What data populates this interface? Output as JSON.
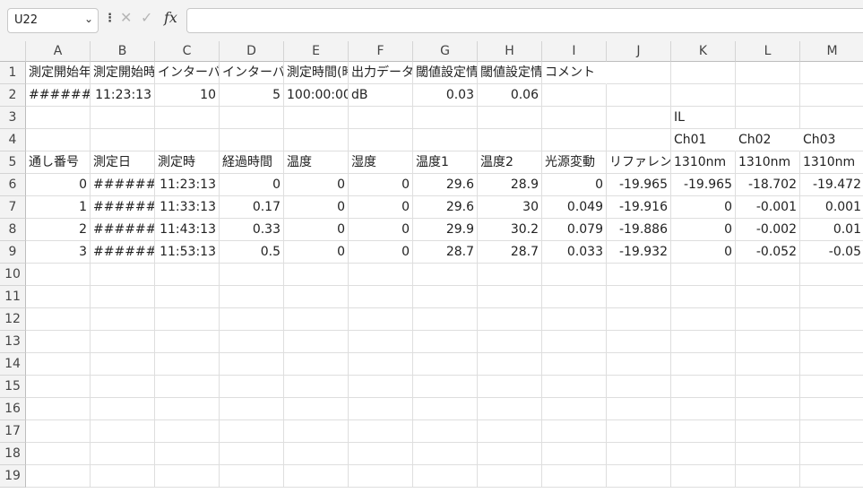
{
  "name_box": {
    "value": "U22",
    "dropdown_icon": "chevron-down-icon"
  },
  "formula_bar": {
    "menu_icon": "more-options-icon",
    "cancel_icon": "cancel-icon",
    "enter_icon": "check-icon",
    "fx_label": "fx",
    "formula": ""
  },
  "columns": [
    "A",
    "B",
    "C",
    "D",
    "E",
    "F",
    "G",
    "H",
    "I",
    "J",
    "K",
    "L",
    "M"
  ],
  "rows": [
    "1",
    "2",
    "3",
    "4",
    "5",
    "6",
    "7",
    "8",
    "9",
    "10",
    "11",
    "12",
    "13",
    "14",
    "15",
    "16",
    "17",
    "18",
    "19"
  ],
  "cells": [
    [
      "測定開始年",
      "測定開始時",
      "インターバ",
      "インターバ",
      "測定時間(時",
      "出力データ",
      "閾値設定情",
      "閾値設定情",
      "コメント",
      "",
      "",
      "",
      ""
    ],
    [
      "#######",
      "11:23:13",
      "10",
      "5",
      "100:00:00",
      "dB",
      "0.03",
      "0.06",
      "",
      "",
      "",
      "",
      ""
    ],
    [
      "",
      "",
      "",
      "",
      "",
      "",
      "",
      "",
      "",
      "",
      "IL",
      "",
      ""
    ],
    [
      "",
      "",
      "",
      "",
      "",
      "",
      "",
      "",
      "",
      "",
      "Ch01",
      "Ch02",
      "Ch03"
    ],
    [
      "通し番号",
      "測定日",
      "測定時",
      "経過時間",
      "温度",
      "湿度",
      "温度1",
      "温度2",
      "光源変動",
      "リファレンス",
      "1310nm",
      "1310nm",
      "1310nm"
    ],
    [
      "0",
      "#######",
      "11:23:13",
      "0",
      "0",
      "0",
      "29.6",
      "28.9",
      "0",
      "-19.965",
      "-19.965",
      "-18.702",
      "-19.472"
    ],
    [
      "1",
      "#######",
      "11:33:13",
      "0.17",
      "0",
      "0",
      "29.6",
      "30",
      "0.049",
      "-19.916",
      "0",
      "-0.001",
      "0.001"
    ],
    [
      "2",
      "#######",
      "11:43:13",
      "0.33",
      "0",
      "0",
      "29.9",
      "30.2",
      "0.079",
      "-19.886",
      "0",
      "-0.002",
      "0.01"
    ],
    [
      "3",
      "#######",
      "11:53:13",
      "0.5",
      "0",
      "0",
      "28.7",
      "28.7",
      "0.033",
      "-19.932",
      "0",
      "-0.052",
      "-0.05"
    ]
  ]
}
